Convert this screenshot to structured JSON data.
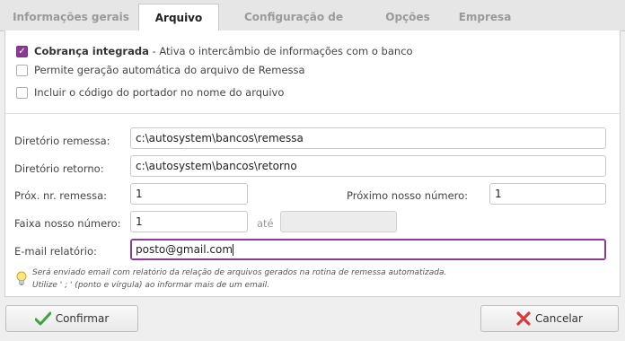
{
  "tabs": [
    {
      "label": "Informações gerais",
      "active": false
    },
    {
      "label": "Arquivo",
      "active": true
    },
    {
      "label": "Configuração de layout",
      "active": false
    },
    {
      "label": "Opções",
      "active": false
    },
    {
      "label": "Empresa",
      "active": false
    }
  ],
  "checkboxes": {
    "cobranca": {
      "bold_label": "Cobrança integrada",
      "label": " - Ativa o intercâmbio de informações com o banco",
      "checked": true
    },
    "remessa_auto": {
      "label": "Permite geração automática do arquivo de Remessa",
      "checked": false
    },
    "portador": {
      "label": "Incluir o código do portador no nome do arquivo",
      "checked": false
    }
  },
  "fields": {
    "dir_remessa": {
      "label": "Diretório remessa:",
      "value": "c:\\autosystem\\bancos\\remessa"
    },
    "dir_retorno": {
      "label": "Diretório retorno:",
      "value": "c:\\autosystem\\bancos\\retorno"
    },
    "prox_remessa": {
      "label": "Próx. nr. remessa:",
      "value": "1"
    },
    "prox_nosso_numero": {
      "label": "Próximo nosso número:",
      "value": "1"
    },
    "faixa": {
      "label": "Faixa nosso número:",
      "value": "1",
      "ate_label": "até",
      "ate_value": ""
    },
    "email": {
      "label": "E-mail relatório:",
      "value": "posto@gmail.com"
    }
  },
  "hint": {
    "icon": "lightbulb-icon",
    "line1": "Será enviado email com relatório da relação de arquivos gerados na rotina de remessa automatizada.",
    "line2": "Utilize ' ; ' (ponto e vírgula) ao informar mais de um email."
  },
  "buttons": {
    "confirm": "Confirmar",
    "cancel": "Cancelar"
  },
  "colors": {
    "accent": "#8a3a94",
    "confirm_icon": "#3aa53a",
    "cancel_icon": "#d93a3a"
  }
}
